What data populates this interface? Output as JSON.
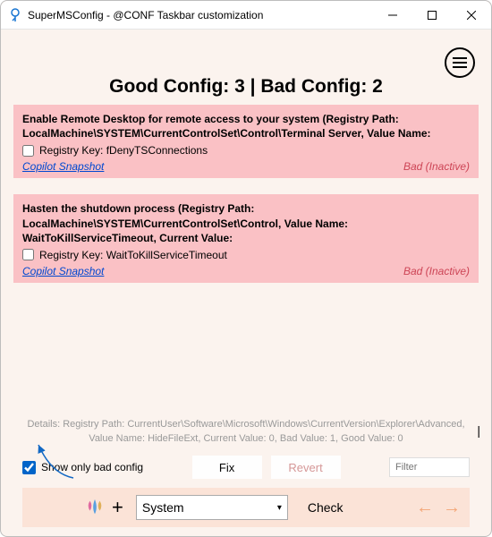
{
  "titlebar": {
    "title": "SuperMSConfig - @CONF Taskbar customization"
  },
  "heading": "Good Config: 3 | Bad Config: 2",
  "cards": [
    {
      "title": "Enable Remote Desktop for remote access to your system (Registry Path: LocalMachine\\SYSTEM\\CurrentControlSet\\Control\\Terminal Server, Value Name:",
      "registry_label": "Registry Key: fDenyTSConnections",
      "snapshot": "Copilot Snapshot",
      "status": "Bad (Inactive)"
    },
    {
      "title": "Hasten the shutdown process (Registry Path: LocalMachine\\SYSTEM\\CurrentControlSet\\Control, Value Name: WaitToKillServiceTimeout, Current Value:",
      "registry_label": "Registry Key: WaitToKillServiceTimeout",
      "snapshot": "Copilot Snapshot",
      "status": "Bad (Inactive)"
    }
  ],
  "details": "Details: Registry Path: CurrentUser\\Software\\Microsoft\\Windows\\CurrentVersion\\Explorer\\Advanced, Value Name: HideFileExt, Current Value: 0, Bad Value: 1, Good Value: 0",
  "controls": {
    "show_bad_label": "Show only bad config",
    "fix_label": "Fix",
    "revert_label": "Revert",
    "filter_placeholder": "Filter"
  },
  "bottom": {
    "plus": "+",
    "category": "System",
    "check_label": "Check"
  }
}
